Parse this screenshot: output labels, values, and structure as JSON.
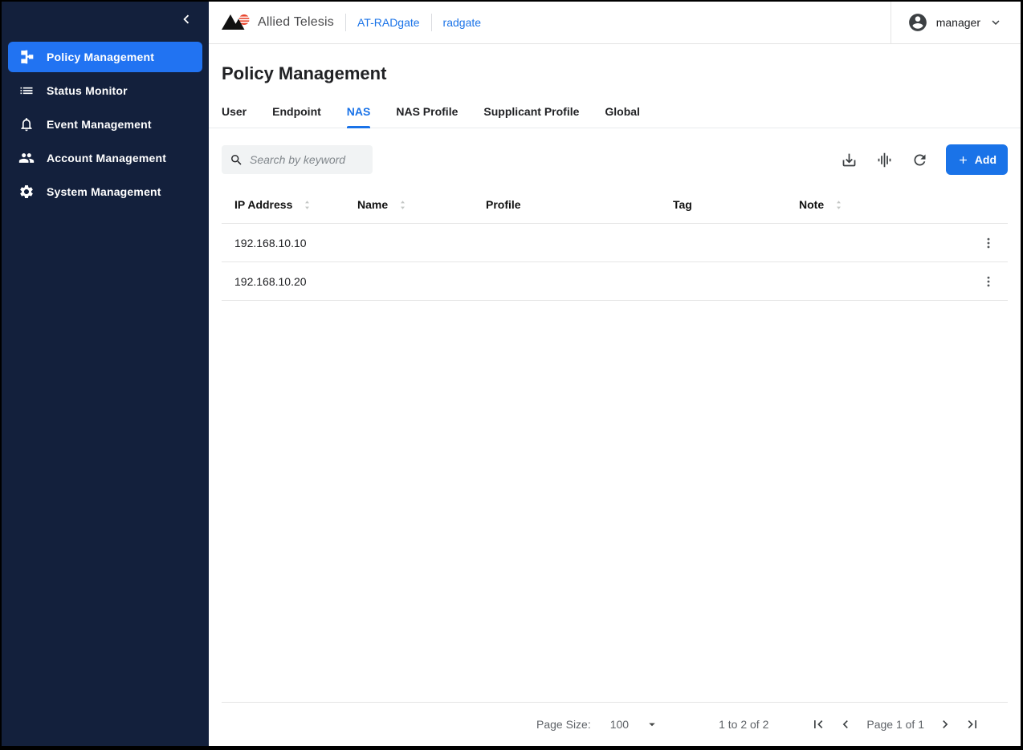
{
  "colors": {
    "accent_blue": "#1a73e8",
    "sidebar_bg": "#13203c",
    "sidebar_active_bg": "#2173f2",
    "add_button_bg": "#1a73e8",
    "search_bg": "#f1f3f4",
    "divider": "#e6e6e6",
    "logo_red": "#e8442c",
    "logo_black": "#111111"
  },
  "header": {
    "brand": "Allied Telesis",
    "product_link": "AT-RADgate",
    "host_link": "radgate",
    "user": {
      "name": "manager",
      "icon": "account-circle-icon",
      "caret": "chevron-down-icon"
    }
  },
  "sidebar": {
    "collapse_icon": "chevron-left-icon",
    "items": [
      {
        "label": "Policy Management",
        "icon": "policy-tree-icon",
        "active": true
      },
      {
        "label": "Status Monitor",
        "icon": "list-icon",
        "active": false
      },
      {
        "label": "Event Management",
        "icon": "bell-icon",
        "active": false
      },
      {
        "label": "Account Management",
        "icon": "people-icon",
        "active": false
      },
      {
        "label": "System Management",
        "icon": "gear-icon",
        "active": false
      }
    ]
  },
  "page": {
    "title": "Policy Management",
    "tabs": [
      {
        "label": "User",
        "active": false
      },
      {
        "label": "Endpoint",
        "active": false
      },
      {
        "label": "NAS",
        "active": true
      },
      {
        "label": "NAS Profile",
        "active": false
      },
      {
        "label": "Supplicant Profile",
        "active": false
      },
      {
        "label": "Global",
        "active": false
      }
    ]
  },
  "toolbar": {
    "search_placeholder": "Search by keyword",
    "search_value": "",
    "icons": [
      "download-icon",
      "equalizer-icon",
      "refresh-icon"
    ],
    "add_button": {
      "icon": "plus-icon",
      "label": "Add"
    }
  },
  "table": {
    "columns": [
      {
        "label": "IP Address",
        "sortable": true
      },
      {
        "label": "Name",
        "sortable": true
      },
      {
        "label": "Profile",
        "sortable": false
      },
      {
        "label": "Tag",
        "sortable": false
      },
      {
        "label": "Note",
        "sortable": true
      }
    ],
    "rows": [
      {
        "ip": "192.168.10.10",
        "name": "",
        "profile": "",
        "tag": "",
        "note": ""
      },
      {
        "ip": "192.168.10.20",
        "name": "",
        "profile": "",
        "tag": "",
        "note": ""
      }
    ]
  },
  "pagination": {
    "page_size_label": "Page Size:",
    "page_size_value": "100",
    "range_text": "1 to 2 of 2",
    "page_text": "Page 1 of 1",
    "icons": [
      "first-page-icon",
      "chevron-left-icon",
      "chevron-right-icon",
      "last-page-icon"
    ]
  }
}
